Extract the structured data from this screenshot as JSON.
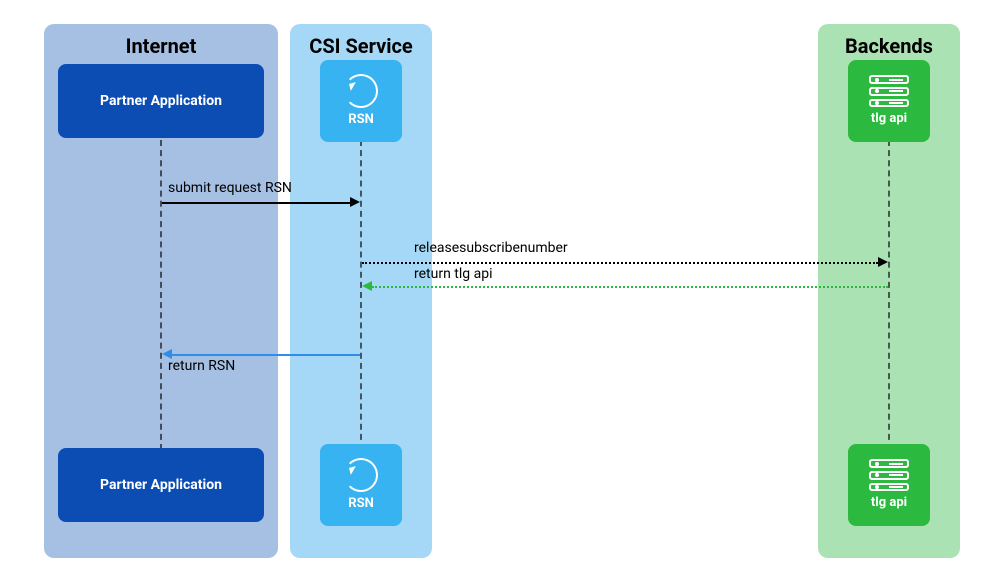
{
  "lanes": {
    "internet": {
      "title": "Internet"
    },
    "csi": {
      "title": "CSI Service"
    },
    "backends": {
      "title": "Backends"
    }
  },
  "nodes": {
    "partner_top": {
      "label": "Partner Application"
    },
    "partner_bottom": {
      "label": "Partner Application"
    },
    "rsn_top": {
      "label": "RSN"
    },
    "rsn_bottom": {
      "label": "RSN"
    },
    "tlg_top": {
      "label": "tlg api"
    },
    "tlg_bottom": {
      "label": "tlg api"
    }
  },
  "messages": {
    "submit_request_rsn": {
      "label": "submit request RSN"
    },
    "releasesubscribenumber": {
      "label": "releasesubscribenumber"
    },
    "return_tlg_api": {
      "label": "return tlg api"
    },
    "return_rsn": {
      "label": "return RSN"
    }
  },
  "colors": {
    "internet_lane": "#a6c0e3",
    "csi_lane": "#a5d8f6",
    "backends_lane": "#abe2b3",
    "partner_box": "#0b4db3",
    "rsn_box": "#36b3f0",
    "tlg_box": "#2bba3f",
    "arrow_black": "#000000",
    "arrow_blue": "#2f8fe6",
    "arrow_green": "#2bba3f"
  },
  "chart_data": {
    "type": "sequence-diagram",
    "participants": [
      {
        "id": "partner",
        "label": "Partner Application",
        "lane": "Internet"
      },
      {
        "id": "rsn",
        "label": "RSN",
        "lane": "CSI Service"
      },
      {
        "id": "tlg",
        "label": "tlg api",
        "lane": "Backends"
      }
    ],
    "messages": [
      {
        "from": "partner",
        "to": "rsn",
        "label": "submit request RSN",
        "style": "solid",
        "color": "#000000"
      },
      {
        "from": "rsn",
        "to": "tlg",
        "label": "releasesubscribenumber",
        "style": "dotted",
        "color": "#000000"
      },
      {
        "from": "tlg",
        "to": "rsn",
        "label": "return tlg api",
        "style": "dotted",
        "color": "#2bba3f"
      },
      {
        "from": "rsn",
        "to": "partner",
        "label": "return RSN",
        "style": "solid",
        "color": "#2f8fe6"
      }
    ]
  }
}
